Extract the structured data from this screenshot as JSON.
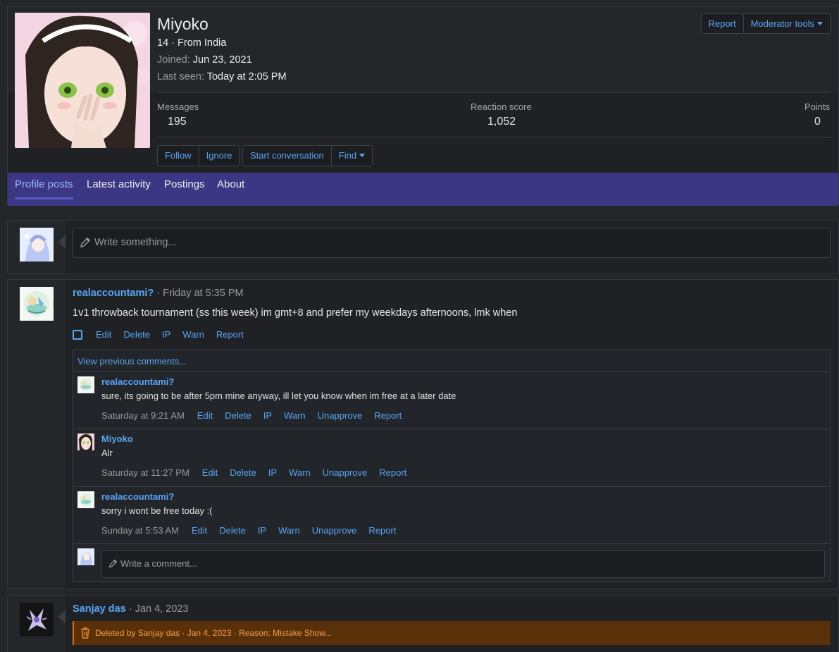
{
  "profile": {
    "name": "Miyoko",
    "info_line": "14 · From India",
    "joined_label": "Joined:",
    "joined_value": "Jun 23, 2021",
    "last_seen_label": "Last seen:",
    "last_seen_value": "Today at 2:05 PM",
    "top_buttons": {
      "report": "Report",
      "moderator_tools": "Moderator tools"
    },
    "stats": [
      {
        "label": "Messages",
        "value": "195"
      },
      {
        "label": "Reaction score",
        "value": "1,052"
      },
      {
        "label": "Points",
        "value": "0"
      }
    ],
    "actions": {
      "follow": "Follow",
      "ignore": "Ignore",
      "start_conversation": "Start conversation",
      "find": "Find"
    }
  },
  "tabs": [
    {
      "label": "Profile posts",
      "active": true
    },
    {
      "label": "Latest activity",
      "active": false
    },
    {
      "label": "Postings",
      "active": false
    },
    {
      "label": "About",
      "active": false
    }
  ],
  "compose": {
    "placeholder": "Write something..."
  },
  "post": {
    "author": "realaccountami?",
    "date": "Friday at 5:35 PM",
    "body": "1v1 throwback tournament (ss this week) im gmt+8 and prefer my weekdays afternoons, lmk when",
    "actions": [
      "Edit",
      "Delete",
      "IP",
      "Warn",
      "Report"
    ],
    "view_previous": "View previous comments...",
    "comments": [
      {
        "author": "realaccountami?",
        "text": "sure, its going to be after 5pm mine anyway, ill let you know when im free at a later date",
        "date": "Saturday at 9:21 AM",
        "actions": [
          "Edit",
          "Delete",
          "IP",
          "Warn",
          "Unapprove",
          "Report"
        ]
      },
      {
        "author": "Miyoko",
        "text": "Alr",
        "date": "Saturday at 11:27 PM",
        "actions": [
          "Edit",
          "Delete",
          "IP",
          "Warn",
          "Unapprove",
          "Report"
        ]
      },
      {
        "author": "realaccountami?",
        "text": "sorry i wont be free today :(",
        "date": "Sunday at 5:53 AM",
        "actions": [
          "Edit",
          "Delete",
          "IP",
          "Warn",
          "Unapprove",
          "Report"
        ]
      }
    ],
    "comment_placeholder": "Write a comment..."
  },
  "deleted_post": {
    "author": "Sanjay das",
    "date": "Jan 4, 2023",
    "notice": "Deleted by Sanjay das · Jan 4, 2023 · Reason: Mistake",
    "show_label": "Show..."
  },
  "colors": {
    "link": "#5aa5f5",
    "tab_bar": "#3b3785",
    "deleted_bg": "#5a3008",
    "deleted_text": "#f0a050"
  }
}
